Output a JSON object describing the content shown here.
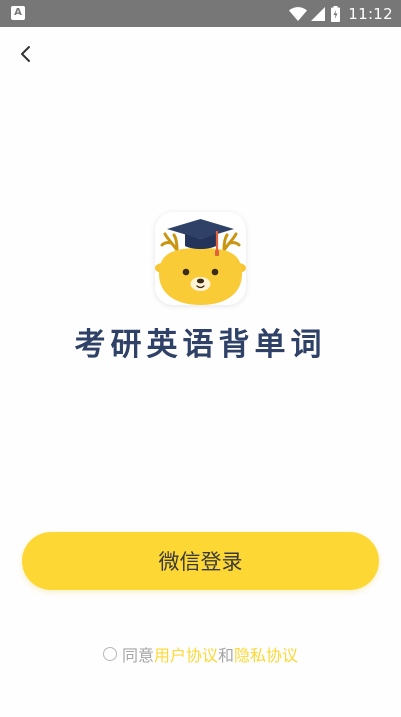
{
  "status_bar": {
    "time": "11:12",
    "left_icon_letter": "A",
    "icons": [
      "notification-a-icon",
      "wifi-icon",
      "signal-icon",
      "battery-charging-icon"
    ]
  },
  "nav": {
    "back_icon": "chevron-left-icon"
  },
  "app": {
    "title": "考研英语背单词",
    "logo_icon": "deer-graduation-cap-logo"
  },
  "login": {
    "button_label": "微信登录"
  },
  "agreement": {
    "prefix": "同意",
    "user_agreement": "用户协议",
    "conjunction": "和",
    "privacy_policy": "隐私协议"
  },
  "colors": {
    "accent": "#fdd835",
    "title_text": "#2f4167",
    "status_bar": "#777777",
    "muted_text": "#a6a6a6"
  }
}
